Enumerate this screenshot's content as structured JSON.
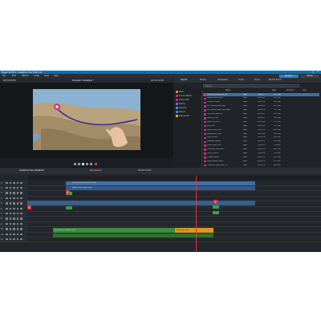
{
  "titlebar": {
    "title": "Magix Vid Pro - Coastline Tour Edit (v1)"
  },
  "menu": [
    "File",
    "Edit",
    "Effects",
    "Audio",
    "View",
    "Help"
  ],
  "header_buttons": {
    "produce": "Produce",
    "share": "Share"
  },
  "monitor": {
    "left_label": "00:00:00:00",
    "title": "Program: Coastline *",
    "right_label": "00:00:12:08"
  },
  "browser": {
    "tabs": [
      "Import",
      "Media",
      "Templates",
      "Fonts",
      "Store",
      "MAGIX Stock"
    ],
    "search_placeholder": "Search",
    "tree": [
      {
        "label": "Music",
        "color": "#e0833a"
      },
      {
        "label": "Sound effects",
        "color": "#c2317e"
      },
      {
        "label": "Video Clips",
        "color": "#c2317e"
      },
      {
        "label": "Photos",
        "color": "#7b5fcf"
      },
      {
        "label": "Projects",
        "color": "#3b8fd0"
      },
      {
        "label": "Recent",
        "color": "#3b8fd0"
      },
      {
        "label": "Downloads",
        "color": "#e0a33a"
      }
    ],
    "columns": [
      "Name",
      "Type",
      "Duration",
      "Size"
    ],
    "rows": [
      {
        "name": "Coastline_map_route_01",
        "type": "mp4",
        "dur": "00:00:12",
        "size": "48.2 MB"
      },
      {
        "name": "Harbor_drone_pass",
        "type": "mp4",
        "dur": "00:00:09",
        "size": "36.0 MB"
      },
      {
        "name": "Cliffside_sunset",
        "type": "mp4",
        "dur": "00:00:15",
        "size": "61.4 MB"
      },
      {
        "name": "HD_Island_aerial_loop",
        "type": "mp4",
        "dur": "00:00:20",
        "size": "82.9 MB"
      },
      {
        "name": "HD_Harbor_boats_timelapse",
        "type": "mp4",
        "dur": "00:00:18",
        "size": "74.1 MB"
      },
      {
        "name": "Old_town_walk_4K",
        "type": "mp4",
        "dur": "00:00:11",
        "size": "90.3 MB"
      },
      {
        "name": "Market_b_roll",
        "type": "mp4",
        "dur": "00:00:07",
        "size": "29.6 MB"
      },
      {
        "name": "Market_b_roll_2",
        "type": "mp4",
        "dur": "00:00:06",
        "size": "25.1 MB"
      },
      {
        "name": "Intro_title",
        "type": "mp4",
        "dur": "00:00:05",
        "size": "12.7 MB"
      },
      {
        "name": "Beach_wide_shot",
        "type": "mp4",
        "dur": "00:00:10",
        "size": "40.2 MB"
      },
      {
        "name": "Lighthouse_close",
        "type": "mp4",
        "dur": "00:00:08",
        "size": "33.8 MB"
      },
      {
        "name": "Ferry_arrival",
        "type": "mp4",
        "dur": "00:00:14",
        "size": "56.5 MB"
      },
      {
        "name": "Sailboat_regatta",
        "type": "mp4",
        "dur": "00:00:13",
        "size": "52.0 MB"
      },
      {
        "name": "Street_food_stall",
        "type": "mp4",
        "dur": "00:00:09",
        "size": "35.4 MB"
      },
      {
        "name": "Mountain_road_drive",
        "type": "mp4",
        "dur": "00:00:16",
        "size": "64.0 MB"
      },
      {
        "name": "Outro_credits",
        "type": "mp4",
        "dur": "00:00:06",
        "size": "14.3 MB"
      },
      {
        "name": "Village_square",
        "type": "mp4",
        "dur": "00:00:12",
        "size": "47.8 MB"
      },
      {
        "name": "Night_harbor_lights",
        "type": "mp4",
        "dur": "00:00:10",
        "size": "41.2 MB"
      },
      {
        "name": "Coastline_map_route_02",
        "type": "mp4",
        "dur": "00:00:12",
        "size": "48.0 MB"
      }
    ]
  },
  "timeline": {
    "tab1": "Coastline Tour (Default)",
    "tab2": "Storyboard",
    "timecode": "00:00:12:08",
    "tracks": [
      "1",
      "2",
      "3",
      "4",
      "5",
      "6",
      "7",
      "8",
      "9",
      "10",
      "11",
      "12"
    ],
    "clips": {
      "video1": "Coastline_map_route_01.mp4",
      "video2": "Harbor_drone_pass.mp4",
      "audio": "Soundtrack_ambient.mp3",
      "audio2": "Voice_over.wav"
    }
  }
}
